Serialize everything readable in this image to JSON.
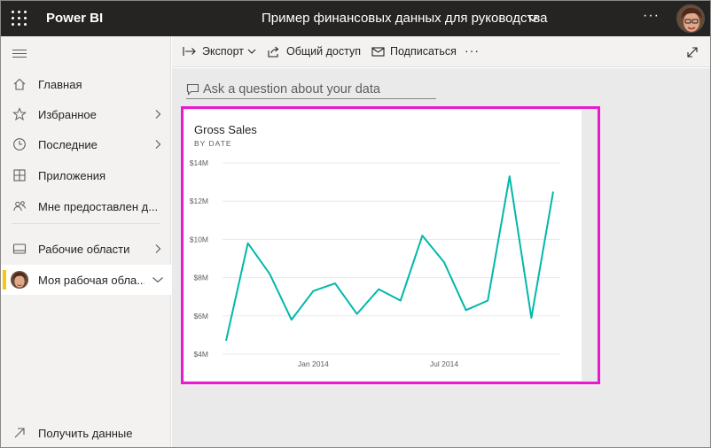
{
  "topbar": {
    "brand": "Power BI",
    "report_title": "Пример финансовых данных для руководства",
    "more": "···"
  },
  "nav": {
    "items": [
      {
        "label": "Главная",
        "icon": "home-icon"
      },
      {
        "label": "Избранное",
        "icon": "star-icon"
      },
      {
        "label": "Последние",
        "icon": "clock-icon"
      },
      {
        "label": "Приложения",
        "icon": "apps-icon"
      },
      {
        "label": "Мне предоставлен д...",
        "icon": "shared-icon"
      },
      {
        "label": "Рабочие области",
        "icon": "workspaces-icon"
      },
      {
        "label": "Моя рабочая обла...",
        "icon": "avatar"
      }
    ],
    "get_data": "Получить данные"
  },
  "actions": {
    "export": "Экспорт",
    "share": "Общий доступ",
    "subscribe": "Подписаться",
    "more": "···"
  },
  "qa": {
    "placeholder": "Ask a question about your data"
  },
  "tile": {
    "title": "Gross Sales",
    "subtitle": "BY DATE"
  },
  "colors": {
    "accent": "#e81ad0",
    "line": "#01b8aa",
    "topbar": "#252423",
    "active_marker": "#f2c811"
  },
  "chart_data": {
    "type": "line",
    "title": "Gross Sales",
    "subtitle": "BY DATE",
    "x": [
      "2013-09",
      "2013-10",
      "2013-11",
      "2013-12",
      "2014-01",
      "2014-02",
      "2014-03",
      "2014-04",
      "2014-05",
      "2014-06",
      "2014-07",
      "2014-08",
      "2014-09",
      "2014-10",
      "2014-11",
      "2014-12"
    ],
    "x_tick_labels": [
      {
        "x": "2014-01",
        "label": "Jan 2014"
      },
      {
        "x": "2014-07",
        "label": "Jul 2014"
      }
    ],
    "series": [
      {
        "values": [
          4.7,
          9.8,
          8.2,
          5.8,
          7.3,
          7.7,
          6.1,
          7.4,
          6.8,
          10.2,
          8.8,
          6.3,
          6.8,
          13.3,
          5.9,
          12.5
        ]
      }
    ],
    "ylim": [
      4,
      14
    ],
    "y_ticks": [
      "$4M",
      "$6M",
      "$8M",
      "$10M",
      "$12M",
      "$14M"
    ],
    "y_tick_values": [
      4,
      6,
      8,
      10,
      12,
      14
    ],
    "grid": true
  }
}
